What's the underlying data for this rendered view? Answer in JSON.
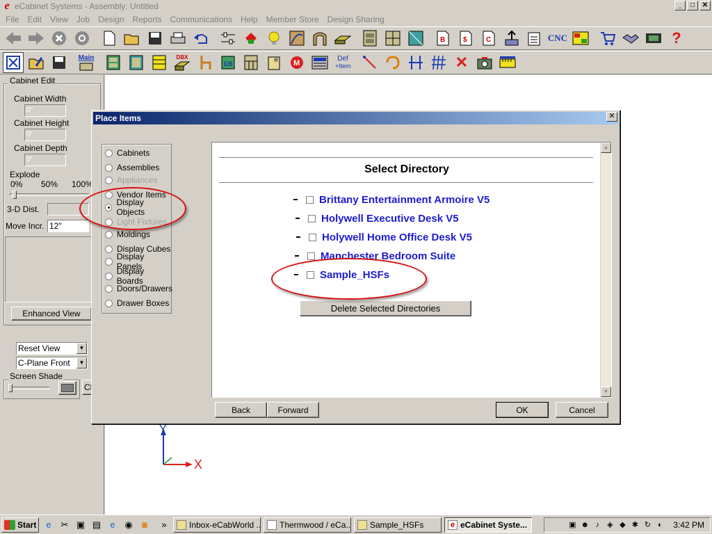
{
  "window": {
    "title": "eCabinet Systems - Assembly: Untitled",
    "app_icon_glyph": "e"
  },
  "menu": [
    "File",
    "Edit",
    "View",
    "Job",
    "Design",
    "Reports",
    "Communications",
    "Help",
    "Member Store",
    "Design Sharing"
  ],
  "toolbar1": {
    "cnc_label": "CNC",
    "icons": [
      "back-arrow-icon",
      "forward-arrow-icon",
      "stop-icon",
      "refresh-icon",
      "new-file-icon",
      "open-folder-icon",
      "save-icon",
      "print-icon",
      "undo-icon",
      "settings-sliders-icon",
      "tag-icon",
      "light-bulb-icon",
      "door-style-icon",
      "arch-icon",
      "panel-icon",
      "cabinet-icon",
      "wall-cabinet-icon",
      "corner-cabinet-icon",
      "bill-icon",
      "cost-icon",
      "cutlist-icon",
      "upload-icon",
      "checklist-icon",
      "cnc-icon",
      "layout-icon",
      "shopping-cart-icon",
      "handshake-icon",
      "film-icon",
      "help-icon"
    ]
  },
  "toolbar2": {
    "main_label": "Main",
    "dbx_label": "DBX",
    "eb_label": "EB",
    "def_label": "Def",
    "item_label": "+Item",
    "icons": [
      "cabinet-edit-icon",
      "pencil-edit-icon",
      "save-icon",
      "main-menu-icon",
      "base-cabinet-icon",
      "tall-cabinet-icon",
      "drawer-bank-icon",
      "dbx-icon",
      "chair-icon",
      "edge-band-icon",
      "hutch-icon",
      "hardware-icon",
      "material-icon",
      "calculator-icon",
      "define-item-icon",
      "pointer-icon",
      "rotate-icon",
      "dimension-icon",
      "grid-icon",
      "delete-icon",
      "camera-icon",
      "measure-icon"
    ]
  },
  "left_panel": {
    "cabinet_edit_title": "Cabinet Edit",
    "cabinet_width_label": "Cabinet Width",
    "cabinet_width_value": "0\"",
    "cabinet_height_label": "Cabinet Height",
    "cabinet_height_value": "0\"",
    "cabinet_depth_label": "Cabinet Depth",
    "cabinet_depth_value": "0\"",
    "explode_title": "Explode",
    "explode_ticks": [
      "0%",
      "50%",
      "100%"
    ],
    "dist_label": "3-D Dist.",
    "move_incr_label": "Move Incr.",
    "move_incr_value": "12\"",
    "enhanced_view_label": "Enhanced View",
    "view_combo": "Reset View",
    "plane_combo": "C-Plane Front",
    "screen_shade_title": "Screen Shade",
    "extra_btn_label": "Ch"
  },
  "axis": {
    "y_label": "Y",
    "x_label": "X"
  },
  "dialog": {
    "title": "Place Items",
    "close_glyph": "✕",
    "radio_options": [
      {
        "label": "Cabinets",
        "checked": false,
        "disabled": false
      },
      {
        "label": "Assemblies",
        "checked": false,
        "disabled": false
      },
      {
        "label": "Appliances",
        "checked": false,
        "disabled": true
      },
      {
        "label": "Vendor Items",
        "checked": false,
        "disabled": false
      },
      {
        "label": "Display Objects",
        "checked": true,
        "disabled": false
      },
      {
        "label": "Light Fixtures",
        "checked": false,
        "disabled": true
      },
      {
        "label": "Moldings",
        "checked": false,
        "disabled": false
      },
      {
        "label": "Display Cubes",
        "checked": false,
        "disabled": false
      },
      {
        "label": "Display Panels",
        "checked": false,
        "disabled": false
      },
      {
        "label": "Display Boards",
        "checked": false,
        "disabled": false
      },
      {
        "label": "Doors/Drawers",
        "checked": false,
        "disabled": false
      },
      {
        "label": "Drawer Boxes",
        "checked": false,
        "disabled": false
      }
    ],
    "heading": "Select Directory",
    "directories": [
      "Brittany Entertainment Armoire V5",
      "Holywell Executive Desk V5",
      "Holywell Home Office Desk V5",
      "Manchester Bedroom Suite",
      "Sample_HSFs"
    ],
    "delete_button": "Delete Selected Directories",
    "back_button": "Back",
    "forward_button": "Forward",
    "ok_button": "OK",
    "cancel_button": "Cancel"
  },
  "taskbar": {
    "start_label": "Start",
    "quicklaunch_more": "»",
    "tasks": [
      {
        "label": "Inbox-eCabWorld ...",
        "active": false
      },
      {
        "label": "Thermwood / eCa...",
        "active": false
      },
      {
        "label": "Sample_HSFs",
        "active": false
      },
      {
        "label": "eCabinet Syste...",
        "active": true
      }
    ],
    "clock": "3:42 PM"
  }
}
